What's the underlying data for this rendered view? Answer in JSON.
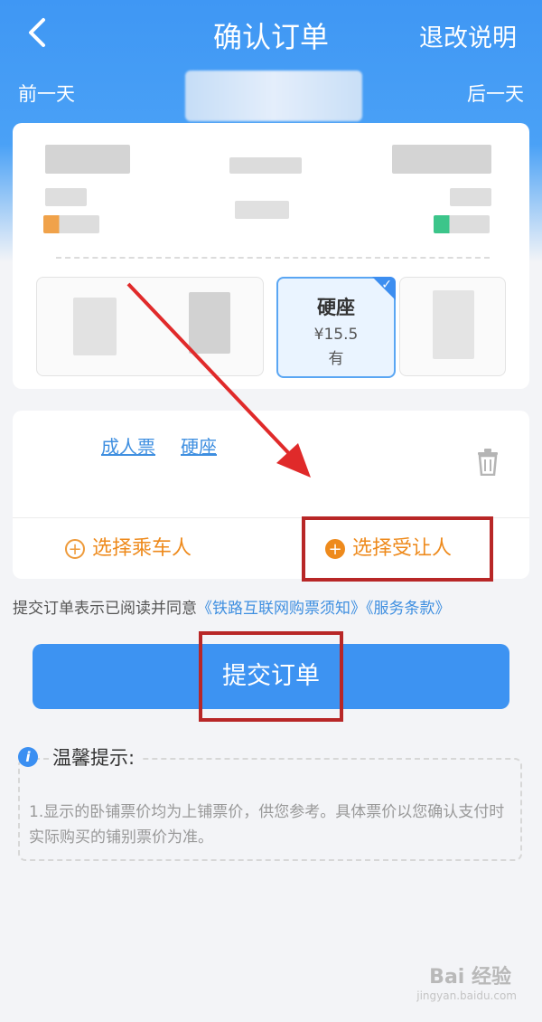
{
  "header": {
    "title": "确认订单",
    "refund_rules": "退改说明",
    "prev_day": "前一天",
    "next_day": "后一天"
  },
  "seats": [
    {
      "name": "硬座",
      "price": "¥15.5",
      "availability": "有",
      "selected": true
    }
  ],
  "passenger": {
    "ticket_type": "成人票",
    "seat_type": "硬座",
    "select_passenger": "选择乘车人",
    "select_beneficiary": "选择受让人"
  },
  "agreement": {
    "prefix": "提交订单表示已阅读并同意",
    "link1": "《铁路互联网购票须知》",
    "link2": "《服务条款》"
  },
  "submit_label": "提交订单",
  "tips": {
    "title": "温馨提示:",
    "text": "1.显示的卧铺票价均为上铺票价，供您参考。具体票价以您确认支付时实际购买的铺别票价为准。"
  },
  "watermark": {
    "brand": "Bai 经验",
    "url": "jingyan.baidu.com"
  },
  "colors": {
    "primary": "#3d93f2",
    "accent_orange": "#ee8a1c",
    "annotation_red": "#b82727"
  }
}
